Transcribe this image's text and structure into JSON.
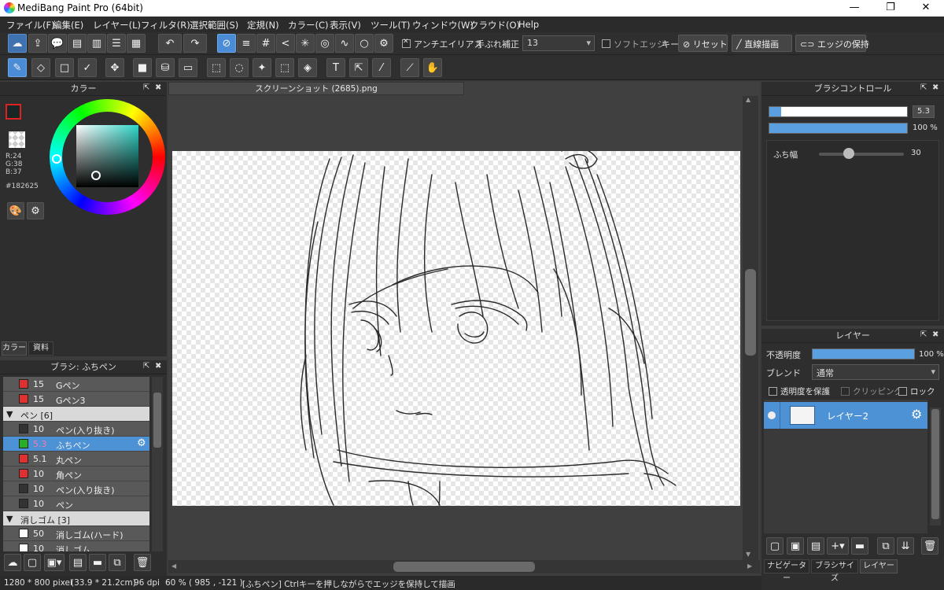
{
  "window": {
    "title": "MediBang Paint Pro (64bit)",
    "minimize": "—",
    "maximize": "❐",
    "close": "✕"
  },
  "menu": [
    "ファイル(F)",
    "編集(E)",
    "レイヤー(L)",
    "フィルタ(R)",
    "選択範囲(S)",
    "定規(N)",
    "カラー(C)",
    "表示(V)",
    "ツール(T)",
    "ウィンドウ(W)",
    "クラウド(O)",
    "Help"
  ],
  "toolbar1": {
    "antialias_label": "アンチエイリアス",
    "stabilizer_label": "手ぶれ補正",
    "stabilizer_value": "13",
    "soft_edge_label": "ソフトエッジ",
    "key_label": "キー",
    "reset_label": "リセット",
    "line_draw_label": "直線描画",
    "keep_edge_label": "エッジの保持"
  },
  "color_panel": {
    "title": "カラー",
    "r": "R:24",
    "g": "G:38",
    "b": "B:37",
    "hex": "#182625",
    "tabs": [
      "カラー",
      "資料"
    ],
    "accent": "#3a6f8f"
  },
  "brush_panel": {
    "title": "ブラシ: ふちペン",
    "rows": [
      {
        "type": "item",
        "color": "#e03030",
        "size": "15",
        "name": "Gペン"
      },
      {
        "type": "item",
        "color": "#e03030",
        "size": "15",
        "name": "Gペン3"
      },
      {
        "type": "group",
        "arrow": "▼",
        "name": "ペン [6]"
      },
      {
        "type": "item",
        "color": "#333333",
        "size": "10",
        "name": "ペン(入り抜き)"
      },
      {
        "type": "selected",
        "color": "#27b027",
        "size": "5.3",
        "name": "ふちペン"
      },
      {
        "type": "item",
        "color": "#e03030",
        "size": "5.1",
        "name": "丸ペン"
      },
      {
        "type": "item",
        "color": "#e03030",
        "size": "10",
        "name": "角ペン"
      },
      {
        "type": "item",
        "color": "#333333",
        "size": "10",
        "name": "ペン(入り抜き)"
      },
      {
        "type": "item",
        "color": "#333333",
        "size": "10",
        "name": "ペン"
      },
      {
        "type": "group",
        "arrow": "▼",
        "name": "消しゴム [3]"
      },
      {
        "type": "item",
        "color": "#ffffff",
        "size": "50",
        "name": "消しゴム(ハード)"
      },
      {
        "type": "item",
        "color": "#ffffff",
        "size": "10",
        "name": "消しゴム"
      }
    ]
  },
  "document": {
    "tab_title": "スクリーンショット (2685).png"
  },
  "brush_control": {
    "title": "ブラシコントロール",
    "size_value": "5.3",
    "opacity_value": "100 %",
    "edge_label": "ふち幅",
    "edge_value": "30"
  },
  "layer_panel": {
    "title": "レイヤー",
    "opacity_label": "不透明度",
    "opacity_value": "100 %",
    "blend_label": "ブレンド",
    "blend_value": "通常",
    "protect_label": "透明度を保護",
    "clipping_label": "クリッピング",
    "lock_label": "ロック",
    "layer_name": "レイヤー2",
    "bottom_tabs": [
      "ナビゲーター",
      "ブラシサイズ",
      "レイヤー"
    ]
  },
  "status": {
    "size": "1280 * 800 pixel",
    "cm": "(33.9 * 21.2cm)",
    "dpi": "96 dpi",
    "zoom": "60 %",
    "coords": "( 985 , -121 )",
    "hint": "[ふちペン] Ctrlキーを押しながらでエッジを保持して描画"
  }
}
